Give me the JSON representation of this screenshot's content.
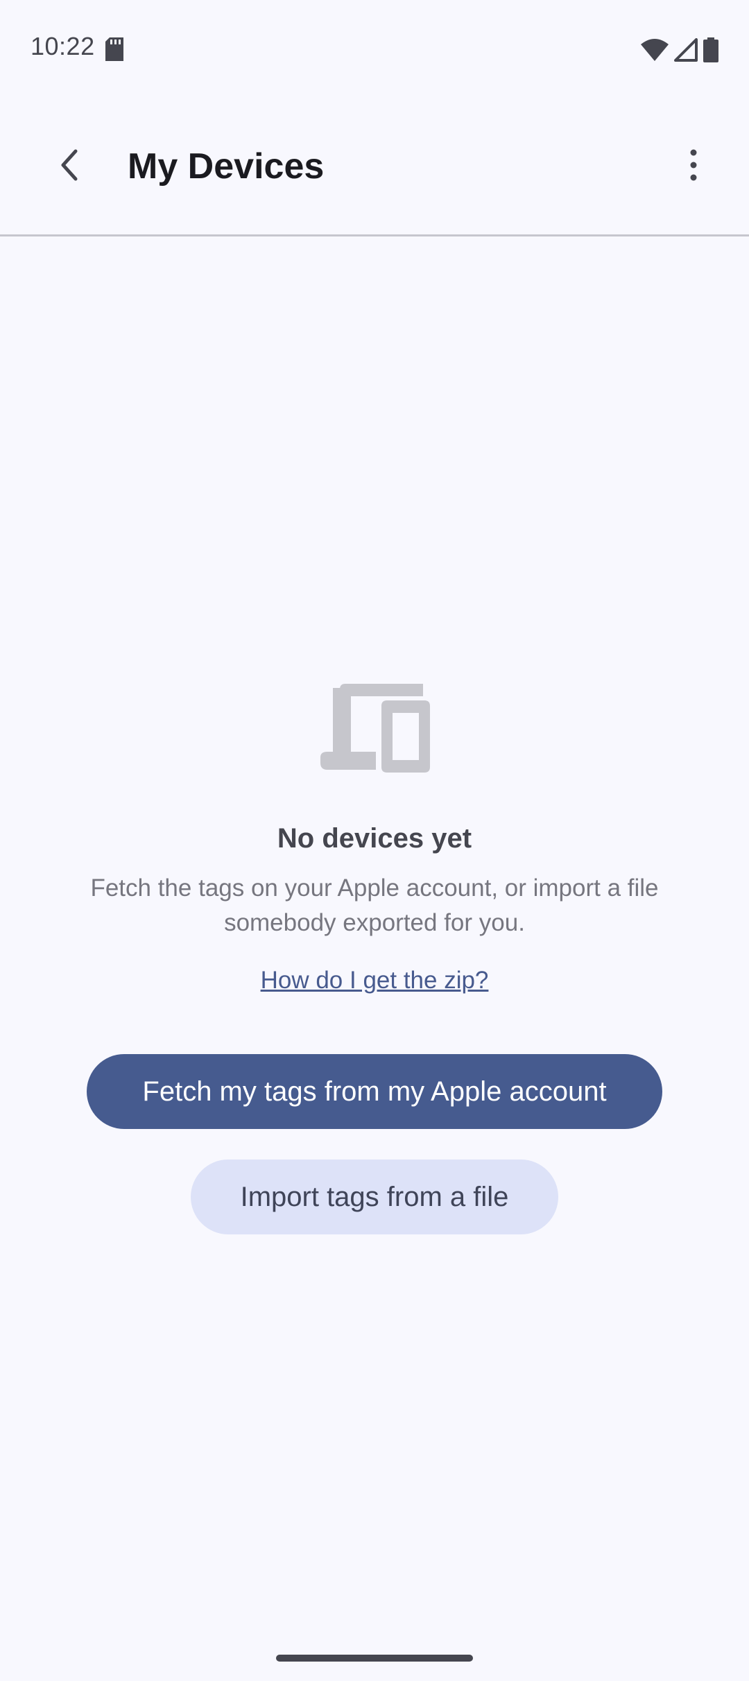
{
  "status_bar": {
    "time": "10:22",
    "icons": [
      "sd-card-icon",
      "wifi-icon",
      "cell-signal-icon",
      "battery-icon"
    ]
  },
  "app_bar": {
    "title": "My Devices",
    "back_icon": "back-arrow-icon",
    "menu_icon": "more-vert-icon"
  },
  "empty_state": {
    "icon": "devices-icon",
    "title": "No devices yet",
    "description": "Fetch the tags on your Apple account, or import a file somebody exported for you.",
    "help_link": "How do I get the zip?",
    "primary_button": "Fetch my tags from my Apple account",
    "secondary_button": "Import tags from a file"
  },
  "colors": {
    "background": "#f8f8fe",
    "primary": "#465b8f",
    "secondary_container": "#dde2f8",
    "link": "#475a8e"
  }
}
